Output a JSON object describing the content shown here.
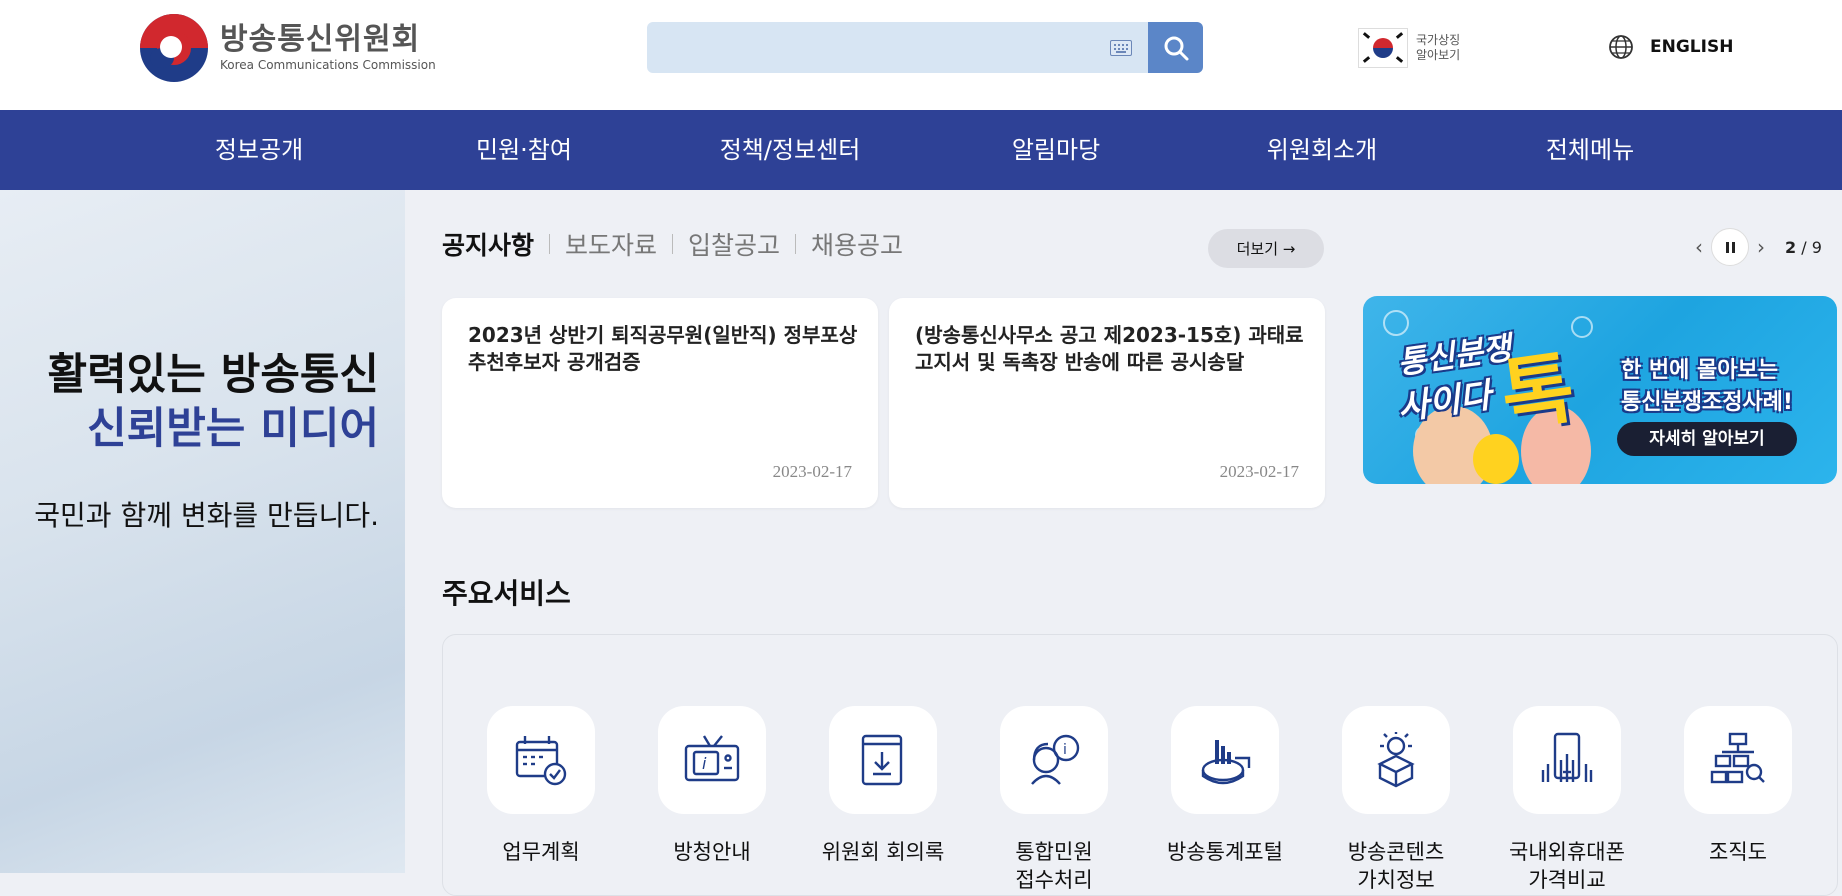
{
  "header": {
    "logo_ko": "방송통신위원회",
    "logo_en": "Korea Communications Commission",
    "search_placeholder": "",
    "symbol_line1": "국가상징",
    "symbol_line2": "알아보기",
    "lang_label": "ENGLISH"
  },
  "nav": {
    "items": [
      {
        "label": "정보공개"
      },
      {
        "label": "민원·참여"
      },
      {
        "label": "정책/정보센터"
      },
      {
        "label": "알림마당"
      },
      {
        "label": "위원회소개"
      },
      {
        "label": "전체메뉴"
      }
    ]
  },
  "hero": {
    "line1": "활력있는 방송통신",
    "line2": "신뢰받는 미디어",
    "sub": "국민과 함께 변화를 만듭니다."
  },
  "notices": {
    "tabs": [
      {
        "label": "공지사항"
      },
      {
        "label": "보도자료"
      },
      {
        "label": "입찰공고"
      },
      {
        "label": "채용공고"
      }
    ],
    "more_label": "더보기 →",
    "cards": [
      {
        "title": "2023년 상반기 퇴직공무원(일반직) 정부포상 추천후보자 공개검증",
        "date": "2023-02-17"
      },
      {
        "title": "(방송통신사무소 공고 제2023-15호) 과태료 고지서 및 독촉장 반송에 따른 공시송달",
        "date": "2023-02-17"
      }
    ]
  },
  "pager": {
    "current": "2",
    "total": "/ 9",
    "prev": "‹",
    "next": "›"
  },
  "banner": {
    "title_a": "통신분쟁",
    "title_b": "사이다",
    "title_c": "톡",
    "desc1": "한 번에 몰아보는",
    "desc2": "통신분쟁조정사례!",
    "button": "자세히 알아보기"
  },
  "services": {
    "title": "주요서비스",
    "items": [
      {
        "label": "업무계획",
        "icon": "calendar-check-icon"
      },
      {
        "label": "방청안내",
        "icon": "tv-info-icon"
      },
      {
        "label": "위원회 회의록",
        "icon": "document-download-icon"
      },
      {
        "label": "통합민원\n접수처리",
        "icon": "consultant-info-icon"
      },
      {
        "label": "방송통계포털",
        "icon": "chart-pie-icon"
      },
      {
        "label": "방송콘텐츠\n가치정보",
        "icon": "idea-box-icon"
      },
      {
        "label": "국내외휴대폰\n가격비교",
        "icon": "phone-compare-icon"
      },
      {
        "label": "조직도",
        "icon": "org-chart-icon"
      }
    ]
  }
}
